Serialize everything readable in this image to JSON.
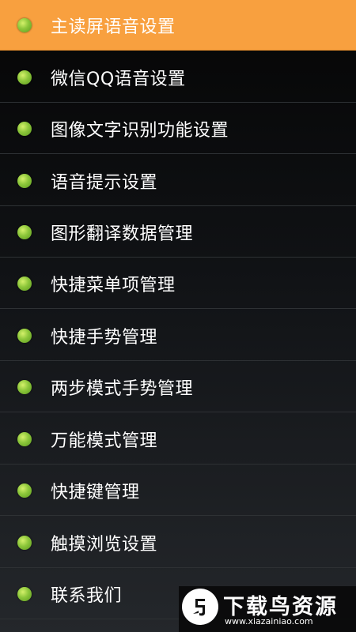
{
  "menu": {
    "items": [
      {
        "label": "主读屏语音设置",
        "selected": true
      },
      {
        "label": "微信QQ语音设置",
        "selected": false
      },
      {
        "label": "图像文字识别功能设置",
        "selected": false
      },
      {
        "label": "语音提示设置",
        "selected": false
      },
      {
        "label": "图形翻译数据管理",
        "selected": false
      },
      {
        "label": "快捷菜单项管理",
        "selected": false
      },
      {
        "label": "快捷手势管理",
        "selected": false
      },
      {
        "label": "两步模式手势管理",
        "selected": false
      },
      {
        "label": "万能模式管理",
        "selected": false
      },
      {
        "label": "快捷键管理",
        "selected": false
      },
      {
        "label": "触摸浏览设置",
        "selected": false
      },
      {
        "label": "联系我们",
        "selected": false
      }
    ],
    "bullet_icon": "green-dot-icon"
  },
  "watermark": {
    "title": "下载鸟资源",
    "url": "www.xiazainiao.com",
    "logo_icon": "bird-logo-icon"
  },
  "colors": {
    "selected_background": "#f8a03f",
    "bullet": "#8cc63a",
    "text": "#ffffff"
  }
}
